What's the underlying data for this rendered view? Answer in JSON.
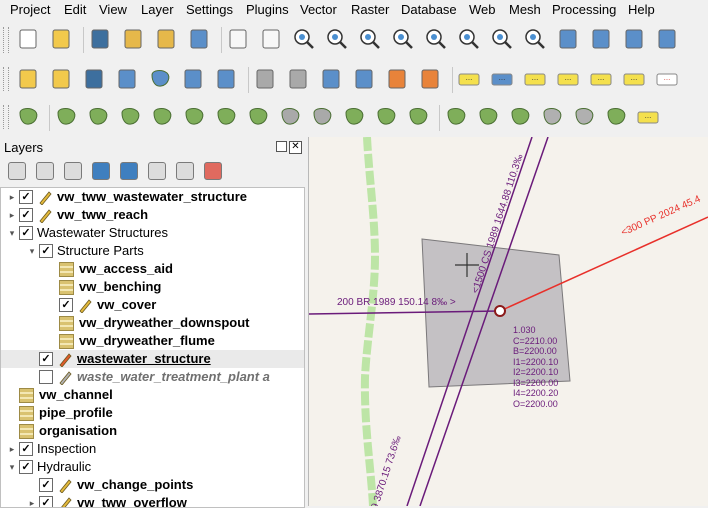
{
  "menubar": {
    "items": [
      "Project",
      "Edit",
      "View",
      "Layer",
      "Settings",
      "Plugins",
      "Vector",
      "Raster",
      "Database",
      "Web",
      "Mesh",
      "Processing",
      "Help"
    ]
  },
  "toolbars": {
    "file_nav_icons": [
      "new-project-icon",
      "open-project-icon",
      "save-project-icon",
      "new-print-layout-icon",
      "style-manager-icon",
      "edit-icon",
      "pan-icon",
      "pan-to-selection-icon",
      "zoom-in-icon",
      "zoom-out-icon",
      "zoom-full-icon",
      "zoom-to-selection-icon",
      "zoom-to-layer-icon",
      "zoom-native-icon",
      "zoom-last-icon",
      "zoom-next-icon",
      "new-map-view-icon",
      "new-3d-map-icon",
      "temporal-controller-icon",
      "refresh-icon"
    ],
    "digitizing_icons": [
      "current-edits-icon",
      "toggle-editing-icon",
      "save-edits-icon",
      "digitize-line-icon",
      "add-polygon-icon",
      "vertex-tool-icon",
      "modify-attributes-icon",
      "delete-selected-icon",
      "cut-icon",
      "copy-icon",
      "paste-icon",
      "undo-icon",
      "redo-icon",
      "label-toolbar-icon",
      "diagram-icon",
      "pin-labels-icon",
      "show-hide-labels-icon",
      "move-label-icon",
      "rotate-label-icon",
      "change-label-icon"
    ],
    "advanced_digitizing_icons": [
      "cad-tools-icon",
      "move-feature-icon",
      "rotate-feature-icon",
      "scale-feature-icon",
      "simplify-feature-icon",
      "add-ring-icon",
      "add-part-icon",
      "fill-ring-icon",
      "delete-ring-icon",
      "delete-part-icon",
      "reshape-feature-icon",
      "offset-curve-icon",
      "split-features-icon",
      "split-parts-icon",
      "merge-features-icon",
      "merge-attributes-icon",
      "rotate-point-symbols-icon",
      "offset-point-symbols-icon",
      "trim-extend-icon",
      "snapping-icon"
    ]
  },
  "layers_panel": {
    "title": "Layers",
    "toolbar_icons": [
      "open-layer-styling-icon",
      "add-group-icon",
      "manage-visibility-icon",
      "filter-legend-icon",
      "filter-expression-icon",
      "expand-all-icon",
      "collapse-all-icon",
      "remove-layer-icon"
    ],
    "rows": [
      {
        "name": "vw_tww_wastewater_structure",
        "indent": 0,
        "arrow": "closed",
        "checked": true,
        "icon": "pencil-point-icon",
        "style": "b"
      },
      {
        "name": "vw_tww_reach",
        "indent": 0,
        "arrow": "closed",
        "checked": true,
        "icon": "pencil-line-icon",
        "style": "b"
      },
      {
        "name": "Wastewater Structures",
        "indent": 0,
        "arrow": "open",
        "checked": true,
        "icon": "",
        "style": ""
      },
      {
        "name": "Structure Parts",
        "indent": 1,
        "arrow": "open",
        "checked": true,
        "icon": "",
        "style": ""
      },
      {
        "name": "vw_access_aid",
        "indent": 2,
        "arrow": "",
        "checked": null,
        "icon": "table-icon",
        "style": "b"
      },
      {
        "name": "vw_benching",
        "indent": 2,
        "arrow": "",
        "checked": null,
        "icon": "table-icon",
        "style": "b"
      },
      {
        "name": "vw_cover",
        "indent": 2,
        "arrow": "",
        "checked": true,
        "icon": "pencil-point-icon",
        "style": "b"
      },
      {
        "name": "vw_dryweather_downspout",
        "indent": 2,
        "arrow": "",
        "checked": null,
        "icon": "table-icon",
        "style": "b"
      },
      {
        "name": "vw_dryweather_flume",
        "indent": 2,
        "arrow": "",
        "checked": null,
        "icon": "table-icon",
        "style": "b"
      },
      {
        "name": "wastewater_structure",
        "indent": 1,
        "arrow": "",
        "checked": true,
        "icon": "pencil-red-icon",
        "style": "b u",
        "selected": true
      },
      {
        "name": "waste_water_treatment_plant a",
        "indent": 1,
        "arrow": "",
        "checked": false,
        "icon": "pencil-grey-icon",
        "style": "b i"
      },
      {
        "name": "vw_channel",
        "indent": 0,
        "arrow": "",
        "checked": null,
        "icon": "table-icon",
        "style": "b"
      },
      {
        "name": "pipe_profile",
        "indent": 0,
        "arrow": "",
        "checked": null,
        "icon": "table-icon",
        "style": "b"
      },
      {
        "name": "organisation",
        "indent": 0,
        "arrow": "",
        "checked": null,
        "icon": "table-icon",
        "style": "b"
      },
      {
        "name": "Inspection",
        "indent": 0,
        "arrow": "closed",
        "checked": true,
        "icon": "",
        "style": ""
      },
      {
        "name": "Hydraulic",
        "indent": 0,
        "arrow": "open",
        "checked": true,
        "icon": "",
        "style": ""
      },
      {
        "name": "vw_change_points",
        "indent": 1,
        "arrow": "",
        "checked": true,
        "icon": "pencil-point-icon",
        "style": "b"
      },
      {
        "name": "vw_tww_overflow",
        "indent": 1,
        "arrow": "closed",
        "checked": true,
        "icon": "pencil-line-icon",
        "style": "b"
      }
    ]
  },
  "map": {
    "labels": {
      "reach_left": "200 BR 1989 150.14 8‰ >",
      "reach_top": "<1500 CS 1989 1644.88 110.3‰",
      "reach_right": "<300 PP 2024 45.4",
      "reach_bottom": "89 3870.15 73.6‰"
    },
    "structure_attributes": [
      "1.030",
      "C=2210.00",
      "B=2200.00",
      "I1=2200.10",
      "I2=2200.10",
      "I3=2200.00",
      "I4=2200.20",
      "O=2200.00"
    ],
    "colors": {
      "background": "#f5f2ec",
      "reach": "#6a1b7a",
      "new_reach": "#e8302a",
      "structure": "#c4c1c4",
      "river": "#b7e39e"
    }
  }
}
